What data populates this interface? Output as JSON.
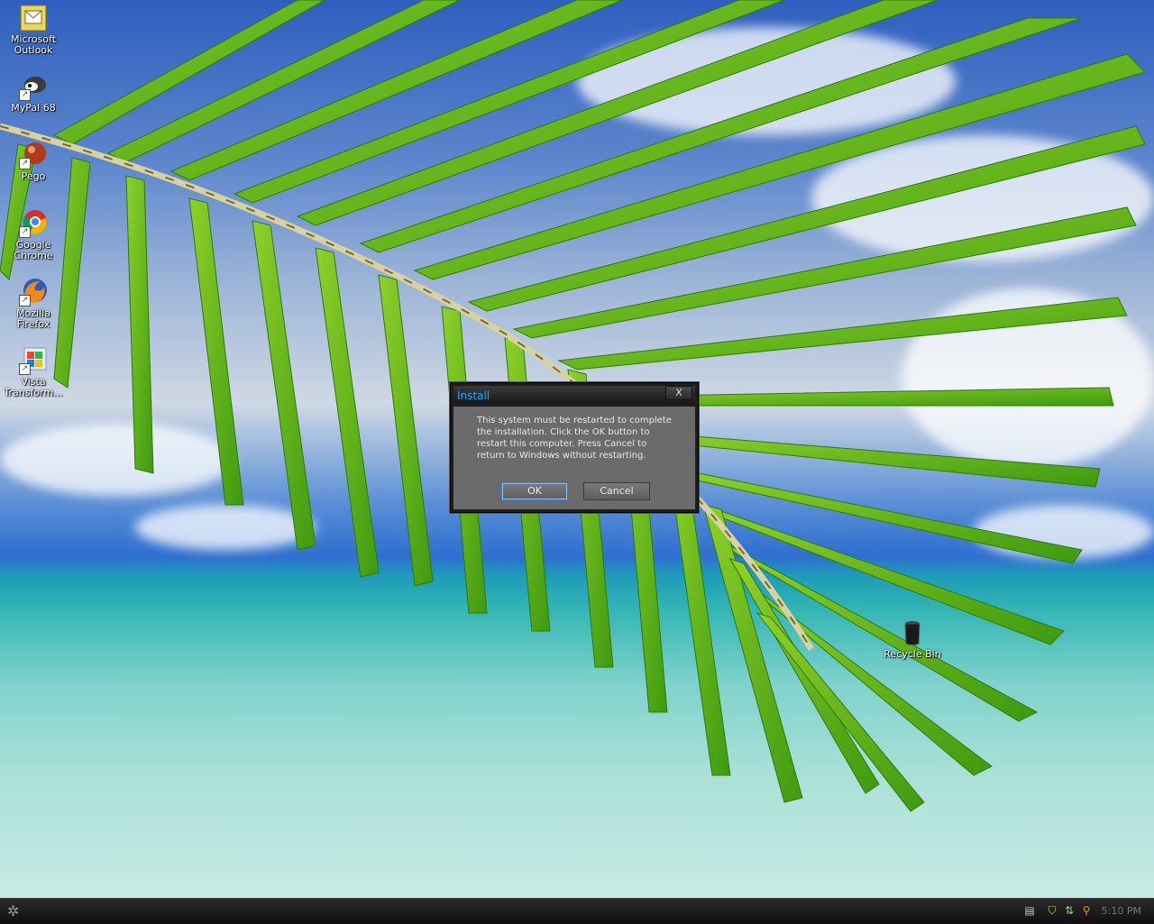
{
  "desktop": {
    "icons": [
      {
        "label_line1": "Microsoft",
        "label_line2": "Outlook",
        "icon": "outlook-icon"
      },
      {
        "label_line1": "MyPal 68",
        "label_line2": "",
        "icon": "mypal-icon"
      },
      {
        "label_line1": "Pego",
        "label_line2": "",
        "icon": "pego-icon"
      },
      {
        "label_line1": "Google",
        "label_line2": "Chrome",
        "icon": "chrome-icon"
      },
      {
        "label_line1": "Mozilla",
        "label_line2": "Firefox",
        "icon": "firefox-icon"
      },
      {
        "label_line1": "Vista",
        "label_line2": "Transform...",
        "icon": "vista-transformation-icon"
      }
    ],
    "recycle_bin": {
      "label": "Recycle Bin",
      "icon": "recycle-bin-icon"
    }
  },
  "dialog": {
    "title": "Install",
    "close_glyph": "X",
    "message": "This system must be restarted to complete the installation. Click the OK button to restart this computer. Press Cancel to return to Windows without restarting.",
    "ok_label": "OK",
    "cancel_label": "Cancel",
    "title_color": "#2fa8ff"
  },
  "taskbar": {
    "clock": "5:10 PM",
    "tray_icons": [
      "keyboard-icon",
      "security-shield-icon",
      "network-icon",
      "search-icon"
    ]
  }
}
